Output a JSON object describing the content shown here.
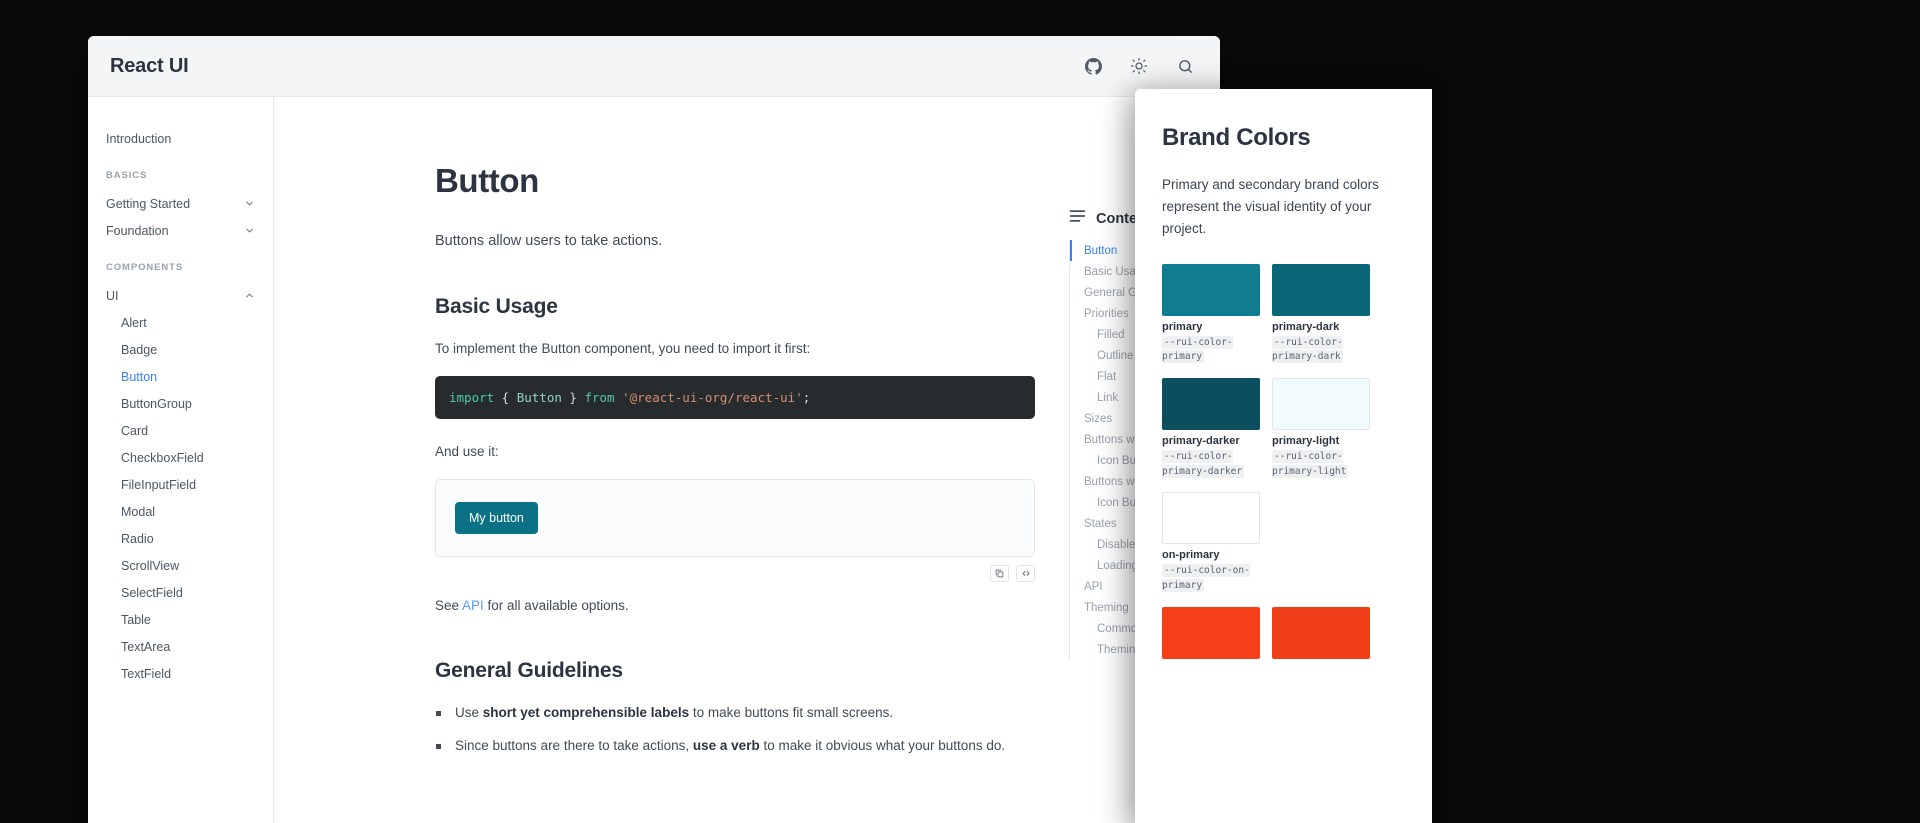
{
  "header": {
    "brand": "React UI",
    "actions": [
      {
        "name": "github-icon",
        "label": "GitHub"
      },
      {
        "name": "sun-icon",
        "label": "Toggle theme"
      },
      {
        "name": "search-icon",
        "label": "Search"
      }
    ]
  },
  "sidebar": {
    "items": [
      {
        "label": "Introduction",
        "type": "link",
        "indent": false,
        "active": false
      },
      {
        "label": "BASICS",
        "type": "section"
      },
      {
        "label": "Getting Started",
        "type": "expandable",
        "indent": false,
        "chevron": "down"
      },
      {
        "label": "Foundation",
        "type": "expandable",
        "indent": false,
        "chevron": "down"
      },
      {
        "label": "COMPONENTS",
        "type": "section"
      },
      {
        "label": "UI",
        "type": "expandable",
        "indent": false,
        "chevron": "up"
      },
      {
        "label": "Alert",
        "type": "link",
        "indent": true,
        "active": false
      },
      {
        "label": "Badge",
        "type": "link",
        "indent": true,
        "active": false
      },
      {
        "label": "Button",
        "type": "link",
        "indent": true,
        "active": true
      },
      {
        "label": "ButtonGroup",
        "type": "link",
        "indent": true,
        "active": false
      },
      {
        "label": "Card",
        "type": "link",
        "indent": true,
        "active": false
      },
      {
        "label": "CheckboxField",
        "type": "link",
        "indent": true,
        "active": false
      },
      {
        "label": "FileInputField",
        "type": "link",
        "indent": true,
        "active": false
      },
      {
        "label": "Modal",
        "type": "link",
        "indent": true,
        "active": false
      },
      {
        "label": "Radio",
        "type": "link",
        "indent": true,
        "active": false
      },
      {
        "label": "ScrollView",
        "type": "link",
        "indent": true,
        "active": false
      },
      {
        "label": "SelectField",
        "type": "link",
        "indent": true,
        "active": false
      },
      {
        "label": "Table",
        "type": "link",
        "indent": true,
        "active": false
      },
      {
        "label": "TextArea",
        "type": "link",
        "indent": true,
        "active": false
      },
      {
        "label": "TextField",
        "type": "link",
        "indent": true,
        "active": false
      }
    ]
  },
  "doc": {
    "title": "Button",
    "lede": "Buttons allow users to take actions.",
    "basic_usage": {
      "heading": "Basic Usage",
      "intro": "To implement the Button component, you need to import it first:",
      "code": {
        "kw_import": "import",
        "brace_open": " { ",
        "identifier": "Button",
        "brace_close": " } ",
        "kw_from": "from",
        "module": " '@react-ui-org/react-ui'",
        "semicolon": ";"
      },
      "and_use_it": "And use it:",
      "demo_button_label": "My button",
      "demo_actions": [
        {
          "name": "copy-icon",
          "label": "Copy"
        },
        {
          "name": "code-icon",
          "label": "View code"
        }
      ],
      "see_api_prefix": "See ",
      "see_api_link": "API",
      "see_api_suffix": " for all available options."
    },
    "general_guidelines": {
      "heading": "General Guidelines",
      "items": [
        {
          "pre": "Use ",
          "bold": "short yet comprehensible labels",
          "post": " to make buttons fit small screens."
        },
        {
          "pre": "Since buttons are there to take actions, ",
          "bold": "use a verb",
          "post": " to make it obvious what your buttons do."
        }
      ]
    }
  },
  "toc": {
    "heading": "Contents",
    "menu_icon": "list-icon",
    "items": [
      {
        "label": "Button",
        "level": 1,
        "active": true
      },
      {
        "label": "Basic Usage",
        "level": 1,
        "active": false
      },
      {
        "label": "General Guidelines",
        "level": 1,
        "active": false
      },
      {
        "label": "Priorities",
        "level": 1,
        "active": false
      },
      {
        "label": "Filled",
        "level": 2,
        "active": false
      },
      {
        "label": "Outline",
        "level": 2,
        "active": false
      },
      {
        "label": "Flat",
        "level": 2,
        "active": false
      },
      {
        "label": "Link",
        "level": 2,
        "active": false
      },
      {
        "label": "Sizes",
        "level": 1,
        "active": false
      },
      {
        "label": "Buttons with Icons",
        "level": 1,
        "active": false
      },
      {
        "label": "Icon Buttons",
        "level": 2,
        "active": false
      },
      {
        "label": "Buttons with Badges",
        "level": 1,
        "active": false
      },
      {
        "label": "Icon Buttons with a Badge",
        "level": 2,
        "active": false
      },
      {
        "label": "States",
        "level": 1,
        "active": false
      },
      {
        "label": "Disabled State",
        "level": 2,
        "active": false
      },
      {
        "label": "Loading State",
        "level": 2,
        "active": false
      },
      {
        "label": "API",
        "level": 1,
        "active": false
      },
      {
        "label": "Theming",
        "level": 1,
        "active": false
      },
      {
        "label": "Common Theming Options",
        "level": 2,
        "active": false
      },
      {
        "label": "Theming Priorities and Variants",
        "level": 2,
        "active": false
      }
    ]
  },
  "brand_panel": {
    "title": "Brand Colors",
    "description": "Primary and secondary brand colors represent the visual identity of your project.",
    "swatches": [
      {
        "name": "primary",
        "var": "--rui-color-primary",
        "hex": "#0f7c90",
        "bordered": false
      },
      {
        "name": "primary-dark",
        "var": "--rui-color-primary-dark",
        "hex": "#0b6778",
        "bordered": false
      },
      {
        "name": "primary-darker",
        "var": "--rui-color-primary-darker",
        "hex": "#0b4f5e",
        "bordered": false
      },
      {
        "name": "primary-light",
        "var": "--rui-color-primary-light",
        "hex": "#f0fbfd",
        "bordered": true
      },
      {
        "name": "on-primary",
        "var": "--rui-color-on-primary",
        "hex": "#ffffff",
        "bordered": true
      },
      {
        "name": "",
        "var": "",
        "hex": "",
        "bordered": false,
        "spacer": true
      },
      {
        "name": "",
        "var": "",
        "hex": "#f5401a",
        "bordered": false
      },
      {
        "name": "",
        "var": "",
        "hex": "#f03f18",
        "bordered": false
      }
    ]
  },
  "colors": {
    "accent_link": "#3b82f6",
    "primary": "#0b7285",
    "text": "#2b3440",
    "muted": "#9aa2ad"
  }
}
